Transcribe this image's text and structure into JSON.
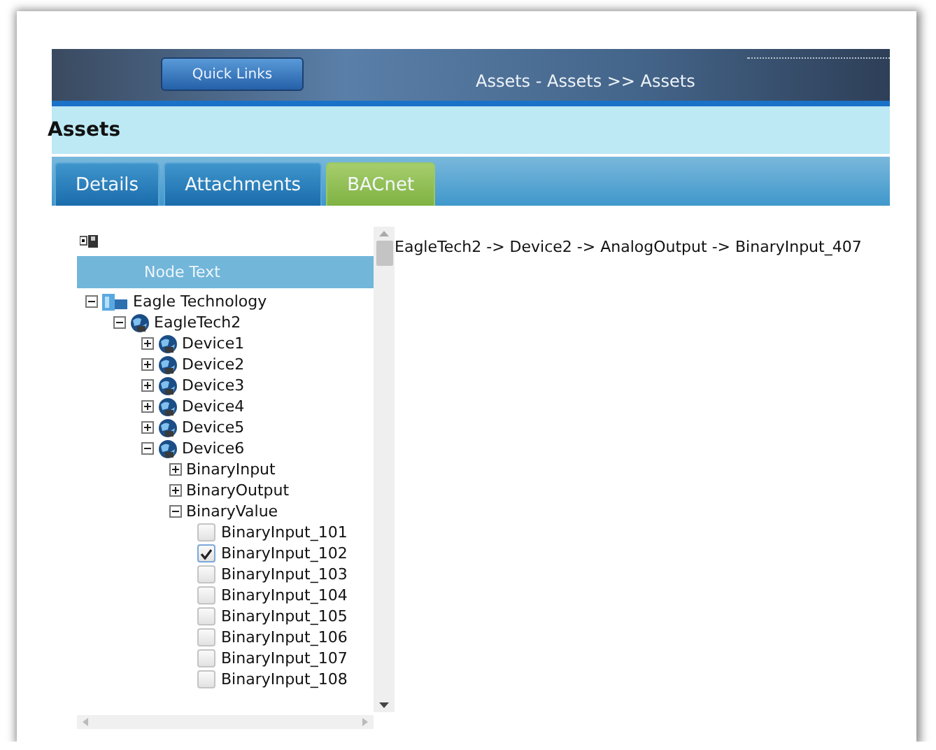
{
  "header": {
    "quick_links": "Quick Links",
    "breadcrumb": "Assets - Assets >> Assets"
  },
  "page_title": "Assets",
  "tabs": [
    {
      "label": "Details",
      "selected": false
    },
    {
      "label": "Attachments",
      "selected": false
    },
    {
      "label": "BACnet",
      "selected": true
    }
  ],
  "tree": {
    "column_header": "Node Text",
    "nodes": [
      {
        "kind": "site",
        "label": "Eagle Technology",
        "expanded": true,
        "children": [
          {
            "kind": "device",
            "label": "EagleTech2",
            "expanded": true,
            "children": [
              {
                "kind": "device",
                "label": "Device1",
                "expanded": false
              },
              {
                "kind": "device",
                "label": "Device2",
                "expanded": false
              },
              {
                "kind": "device",
                "label": "Device3",
                "expanded": false
              },
              {
                "kind": "device",
                "label": "Device4",
                "expanded": false
              },
              {
                "kind": "device",
                "label": "Device5",
                "expanded": false
              },
              {
                "kind": "device",
                "label": "Device6",
                "expanded": true,
                "children": [
                  {
                    "kind": "group",
                    "label": "BinaryInput",
                    "expanded": false
                  },
                  {
                    "kind": "group",
                    "label": "BinaryOutput",
                    "expanded": false
                  },
                  {
                    "kind": "group",
                    "label": "BinaryValue",
                    "expanded": true,
                    "children": [
                      {
                        "kind": "point",
                        "label": "BinaryInput_101",
                        "checked": false
                      },
                      {
                        "kind": "point",
                        "label": "BinaryInput_102",
                        "checked": true
                      },
                      {
                        "kind": "point",
                        "label": "BinaryInput_103",
                        "checked": false
                      },
                      {
                        "kind": "point",
                        "label": "BinaryInput_104",
                        "checked": false
                      },
                      {
                        "kind": "point",
                        "label": "BinaryInput_105",
                        "checked": false
                      },
                      {
                        "kind": "point",
                        "label": "BinaryInput_106",
                        "checked": false
                      },
                      {
                        "kind": "point",
                        "label": "BinaryInput_107",
                        "checked": false
                      },
                      {
                        "kind": "point",
                        "label": "BinaryInput_108",
                        "checked": false
                      }
                    ]
                  }
                ]
              }
            ]
          }
        ]
      }
    ]
  },
  "selected_path": "EagleTech2 -> Device2 -> AnalogOutput -> BinaryInput_407"
}
